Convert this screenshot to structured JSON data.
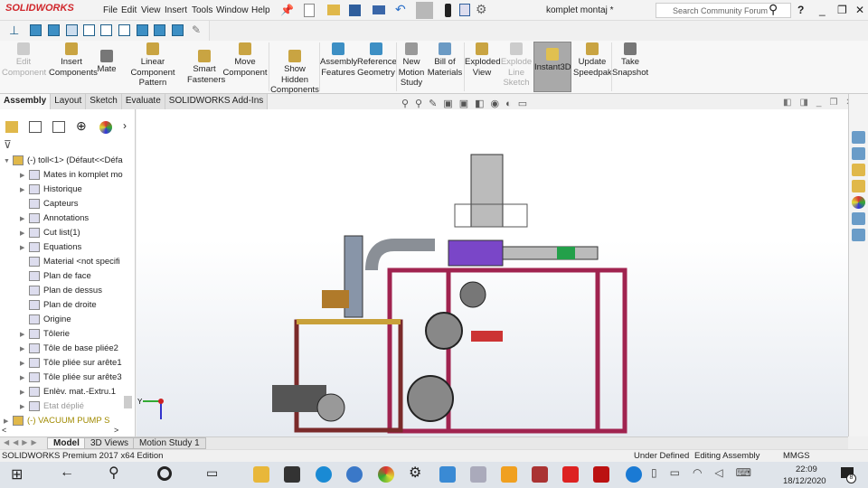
{
  "app": {
    "logo": "SOLIDWORKS",
    "title": "komplet montaj *",
    "search_placeholder": "Search Community Forum",
    "help": "?"
  },
  "menu": [
    "File",
    "Edit",
    "View",
    "Insert",
    "Tools",
    "Window",
    "Help"
  ],
  "commands": [
    {
      "label": "Edit Component",
      "disabled": true
    },
    {
      "label": "Insert Components"
    },
    {
      "label": "Mate"
    },
    {
      "label": "Linear Component Pattern"
    },
    {
      "label": "Smart Fasteners"
    },
    {
      "label": "Move Component"
    },
    {
      "label": "Show Hidden Components"
    },
    {
      "label": "Assembly Features"
    },
    {
      "label": "Reference Geometry"
    },
    {
      "label": "New Motion Study"
    },
    {
      "label": "Bill of Materials"
    },
    {
      "label": "Exploded View"
    },
    {
      "label": "Explode Line Sketch",
      "disabled": true
    },
    {
      "label": "Instant3D",
      "active": true
    },
    {
      "label": "Update Speedpak"
    },
    {
      "label": "Take Snapshot"
    }
  ],
  "tabs": [
    "Assembly",
    "Layout",
    "Sketch",
    "Evaluate",
    "SOLIDWORKS Add-Ins"
  ],
  "tree": [
    {
      "label": "(-) toll<1> (Défaut<<Défa",
      "expand": "▼"
    },
    {
      "label": "Mates in komplet mo",
      "expand": "▶"
    },
    {
      "label": "Historique",
      "expand": "▶"
    },
    {
      "label": "Capteurs",
      "expand": ""
    },
    {
      "label": "Annotations",
      "expand": "▶"
    },
    {
      "label": "Cut list(1)",
      "expand": "▶"
    },
    {
      "label": "Equations",
      "expand": "▶"
    },
    {
      "label": "Material <not specifi",
      "expand": ""
    },
    {
      "label": "Plan de face",
      "expand": ""
    },
    {
      "label": "Plan de dessus",
      "expand": ""
    },
    {
      "label": "Plan de droite",
      "expand": ""
    },
    {
      "label": "Origine",
      "expand": ""
    },
    {
      "label": "Tôlerie",
      "expand": "▶"
    },
    {
      "label": "Tôle de base pliée2",
      "expand": "▶"
    },
    {
      "label": "Tôle pliée sur arête1",
      "expand": "▶"
    },
    {
      "label": "Tôle pliée sur arête3",
      "expand": "▶"
    },
    {
      "label": "Enlèv. mat.-Extru.1",
      "expand": "▶"
    },
    {
      "label": "Etat déplié",
      "expand": "▶"
    },
    {
      "label": "(-) VACUUM PUMP S",
      "expand": "▶"
    }
  ],
  "bottom_tabs": [
    "Model",
    "3D Views",
    "Motion Study 1"
  ],
  "status": {
    "edition": "SOLIDWORKS Premium 2017 x64 Edition",
    "state": "Under Defined",
    "mode": "Editing Assembly",
    "units": "MMGS"
  },
  "taskbar": {
    "time": "22:09",
    "date": "18/12/2020",
    "notifications": "8"
  },
  "axis": {
    "y": "Y"
  }
}
